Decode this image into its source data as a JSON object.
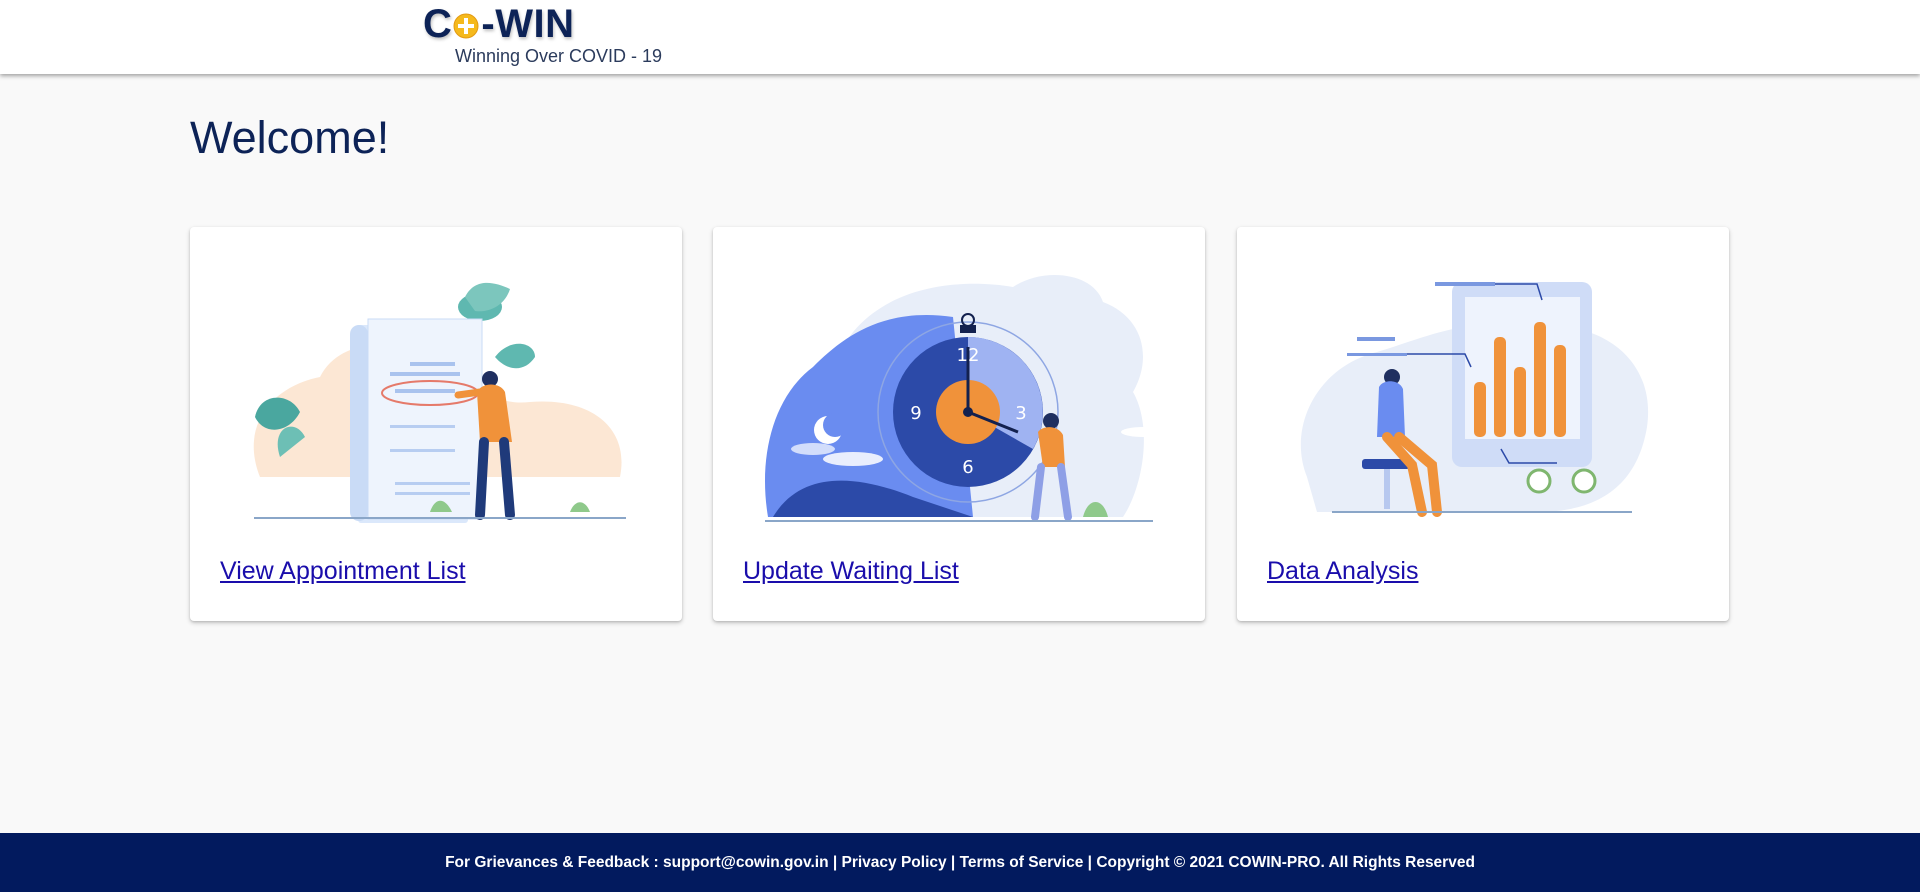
{
  "header": {
    "logo_prefix": "C",
    "logo_suffix": "-WIN",
    "logo_tagline": "Winning Over COVID - 19"
  },
  "main": {
    "title": "Welcome!",
    "cards": [
      {
        "label": "View Appointment List",
        "illustration": "document-checklist-illustration"
      },
      {
        "label": "Update Waiting List",
        "illustration": "clock-illustration"
      },
      {
        "label": "Data Analysis",
        "illustration": "bar-chart-illustration"
      }
    ],
    "clock_numbers": [
      "12",
      "3",
      "6",
      "9"
    ]
  },
  "footer": {
    "grievance_text": "For Grievances & Feedback : support@cowin.gov.in",
    "sep1": " | ",
    "privacy": "Privacy Policy",
    "sep2": " | ",
    "terms": "Terms of Service",
    "sep3": " | ",
    "copyright": "Copyright © 2021 COWIN-PRO. All Rights Reserved"
  },
  "colors": {
    "navy": "#0d2357",
    "footer_bg": "#021a5e",
    "link": "#1a0dab",
    "accent_orange": "#f0923a",
    "accent_blue": "#6a8cf0"
  }
}
